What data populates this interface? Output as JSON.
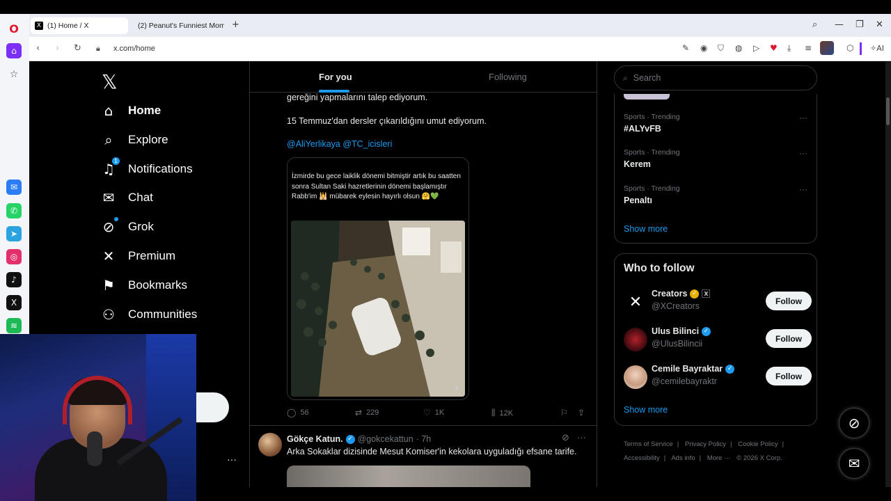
{
  "browser": {
    "tabs": [
      {
        "title": "(1) Home / X",
        "active": true
      },
      {
        "title": "(2) Peanut's Funniest Mom",
        "active": false
      }
    ],
    "url": "x.com/home",
    "ai_label": "AI"
  },
  "opera_sidebar": {
    "icons": [
      "opera-logo-icon",
      "home-icon",
      "star-icon",
      "messenger-icon",
      "whatsapp-icon",
      "telegram-icon",
      "instagram-icon",
      "tiktok-icon",
      "x-icon",
      "spotify-icon"
    ]
  },
  "nav": {
    "items": [
      {
        "label": "Home",
        "icon": "⌂",
        "active": true
      },
      {
        "label": "Explore",
        "icon": "⌕"
      },
      {
        "label": "Notifications",
        "icon": "🔔︎",
        "badge": "1"
      },
      {
        "label": "Chat",
        "icon": "✉"
      },
      {
        "label": "Grok",
        "icon": "⊘"
      },
      {
        "label": "Premium",
        "icon": "✕"
      },
      {
        "label": "Bookmarks",
        "icon": "⚑"
      },
      {
        "label": "Communities",
        "icon": "⚇"
      }
    ],
    "more": "···"
  },
  "feed": {
    "tabs": {
      "for_you": "For you",
      "following": "Following"
    },
    "tweet1": {
      "line1": "gereğini yapmalarını talep ediyorum.",
      "line2": "15 Temmuz'dan dersler çıkarıldığını umut ediyorum.",
      "mentions": "@AliYerlikaya @TC_icisleri",
      "quote_text": "İzmirde bu gece laiklik dönemi bitmiştir artık bu saatten sonra Sultan Saki hazretlerinin dönemi başlamıştır Rabb'im 🕌 mübarek eylesin hayırlı olsun 🤗💚",
      "stats": {
        "replies": "56",
        "reposts": "229",
        "likes": "1K",
        "views": "12K"
      }
    },
    "tweet2": {
      "name": "Gökçe Katun.",
      "handle": "@gokcekattun",
      "time": "· 7h",
      "text": "Arka Sokaklar dizisinde Mesut Komiser'in kekolara uyguladığı efsane tarife."
    }
  },
  "right": {
    "search_placeholder": "Search",
    "trends": [
      {
        "meta": "Sports · Trending",
        "name": "#ALYvFB"
      },
      {
        "meta": "Sports · Trending",
        "name": "Kerem"
      },
      {
        "meta": "Sports · Trending",
        "name": "Penaltı"
      }
    ],
    "show_more": "Show more",
    "who_title": "Who to follow",
    "who": [
      {
        "name": "Creators",
        "handle": "@XCreators",
        "verified": "gold",
        "button": "Follow"
      },
      {
        "name": "Ulus Bilinci",
        "handle": "@UlusBilincii",
        "verified": "blue",
        "button": "Follow"
      },
      {
        "name": "Cemile Bayraktar",
        "handle": "@cemilebayraktr",
        "verified": "blue",
        "button": "Follow"
      }
    ],
    "who_show_more": "Show more",
    "footer": [
      "Terms of Service",
      "|",
      "Privacy Policy",
      "|",
      "Cookie Policy",
      "|",
      "Accessibility",
      "|",
      "Ads info",
      "|",
      "More ···",
      "© 2026 X Corp."
    ]
  },
  "colors": {
    "accent": "#1d9bf0",
    "bg": "#000000",
    "border": "#2f3336",
    "muted": "#71767b"
  }
}
